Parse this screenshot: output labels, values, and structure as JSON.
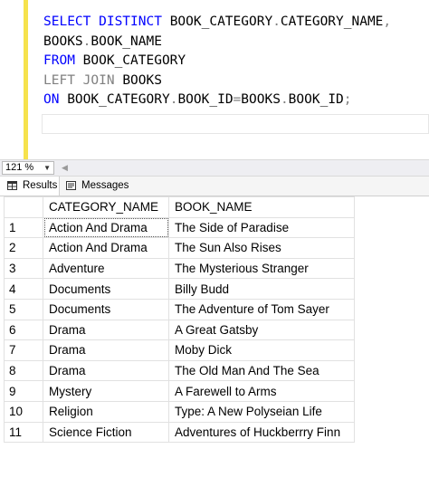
{
  "editor": {
    "lines": [
      [
        {
          "t": "SELECT DISTINCT ",
          "c": "kw"
        },
        {
          "t": "BOOK_CATEGORY",
          "c": "pl"
        },
        {
          "t": ".",
          "c": "gr"
        },
        {
          "t": "CATEGORY_NAME",
          "c": "pl"
        },
        {
          "t": ",",
          "c": "gr"
        }
      ],
      [
        {
          "t": "BOOKS",
          "c": "pl"
        },
        {
          "t": ".",
          "c": "gr"
        },
        {
          "t": "BOOK_NAME",
          "c": "pl"
        }
      ],
      [
        {
          "t": "FROM ",
          "c": "kw"
        },
        {
          "t": "BOOK_CATEGORY",
          "c": "pl"
        }
      ],
      [
        {
          "t": "LEFT JOIN ",
          "c": "gr"
        },
        {
          "t": "BOOKS",
          "c": "pl"
        }
      ],
      [
        {
          "t": "ON ",
          "c": "kw"
        },
        {
          "t": "BOOK_CATEGORY",
          "c": "pl"
        },
        {
          "t": ".",
          "c": "gr"
        },
        {
          "t": "BOOK_ID",
          "c": "pl"
        },
        {
          "t": "=",
          "c": "gr"
        },
        {
          "t": "BOOKS",
          "c": "pl"
        },
        {
          "t": ".",
          "c": "gr"
        },
        {
          "t": "BOOK_ID",
          "c": "pl"
        },
        {
          "t": ";",
          "c": "gr"
        }
      ]
    ]
  },
  "zoom": {
    "value": "121 %"
  },
  "tabs": {
    "results": "Results",
    "messages": "Messages"
  },
  "grid": {
    "columns": [
      "CATEGORY_NAME",
      "BOOK_NAME"
    ],
    "rows": [
      [
        "1",
        "Action And Drama",
        "The Side of Paradise"
      ],
      [
        "2",
        "Action And Drama",
        "The Sun Also Rises"
      ],
      [
        "3",
        "Adventure",
        "The Mysterious Stranger"
      ],
      [
        "4",
        "Documents",
        "Billy Budd"
      ],
      [
        "5",
        "Documents",
        "The Adventure of Tom Sayer"
      ],
      [
        "6",
        "Drama",
        "A Great Gatsby"
      ],
      [
        "7",
        "Drama",
        "Moby Dick"
      ],
      [
        "8",
        "Drama",
        "The Old Man And The Sea"
      ],
      [
        "9",
        "Mystery",
        "A Farewell to Arms"
      ],
      [
        "10",
        "Religion",
        "Type: A New Polyseian Life"
      ],
      [
        "11",
        "Science Fiction",
        "Adventures of Huckberrry Finn"
      ]
    ]
  },
  "colors": {
    "keyword": "#0000ff",
    "operator": "#808080",
    "margin_bar": "#f6e24c"
  }
}
